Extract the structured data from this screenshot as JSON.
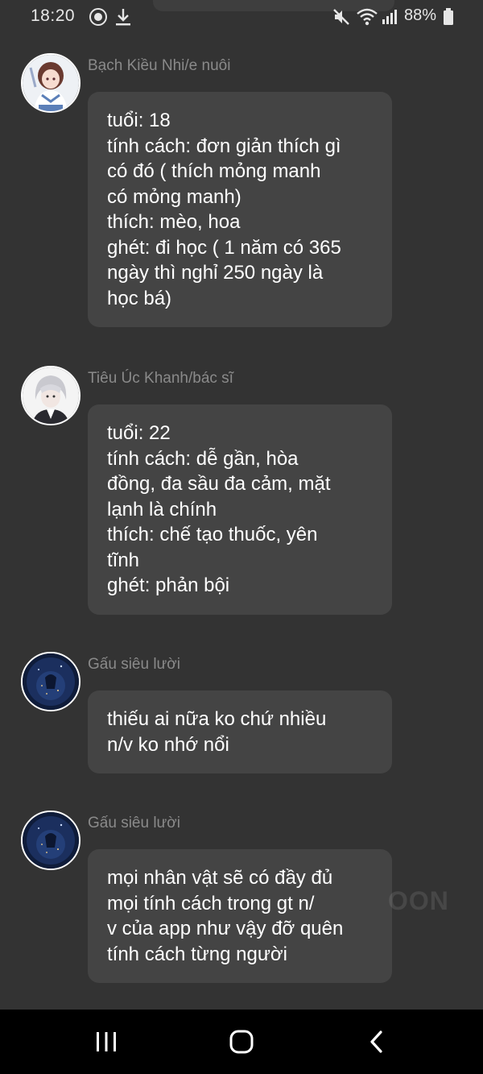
{
  "status_bar": {
    "time": "18:20",
    "battery": "88%",
    "icons": [
      "messenger-icon",
      "download-icon",
      "mute-icon",
      "wifi-icon",
      "signal-icon",
      "battery-icon"
    ]
  },
  "messages": [
    {
      "sender": "Bạch Kiều Nhi/e nuôi",
      "avatar": "anime-girl-avatar",
      "lines": [
        "tuổi: 18",
        "tính cách: đơn giản thích gì",
        "có đó ( thích mỏng manh",
        "có mỏng manh)",
        "thích: mèo, hoa",
        "ghét: đi học ( 1 năm có 365",
        "ngày thì nghỉ 250 ngày là",
        "học bá)"
      ]
    },
    {
      "sender": "Tiêu Úc Khanh/bác sĩ",
      "avatar": "anime-boy-avatar",
      "lines": [
        "tuổi: 22",
        "tính cách: dễ gần, hòa",
        "đồng, đa sầu đa cảm, mặt",
        "lạnh là chính",
        "thích: chế tạo thuốc, yên",
        "tĩnh",
        "ghét: phản bội"
      ]
    },
    {
      "sender": "Gấu siêu lười",
      "avatar": "night-sky-avatar",
      "lines": [
        "thiếu ai nữa ko chứ nhiều",
        "n/v ko nhớ nổi"
      ]
    },
    {
      "sender": "Gấu siêu lười",
      "avatar": "night-sky-avatar",
      "lines": [
        "mọi nhân vật sẽ có đầy đủ",
        "mọi tính cách trong gt n/",
        "v của app như vậy đỡ quên",
        "tính cách từng người"
      ]
    }
  ],
  "watermark": "OON",
  "nav_bar": {
    "buttons": [
      "recent-apps",
      "home",
      "back"
    ]
  },
  "colors": {
    "background": "#333333",
    "bubble": "#444444",
    "sender_name": "#8a8a8a",
    "nav_bar": "#000000"
  }
}
